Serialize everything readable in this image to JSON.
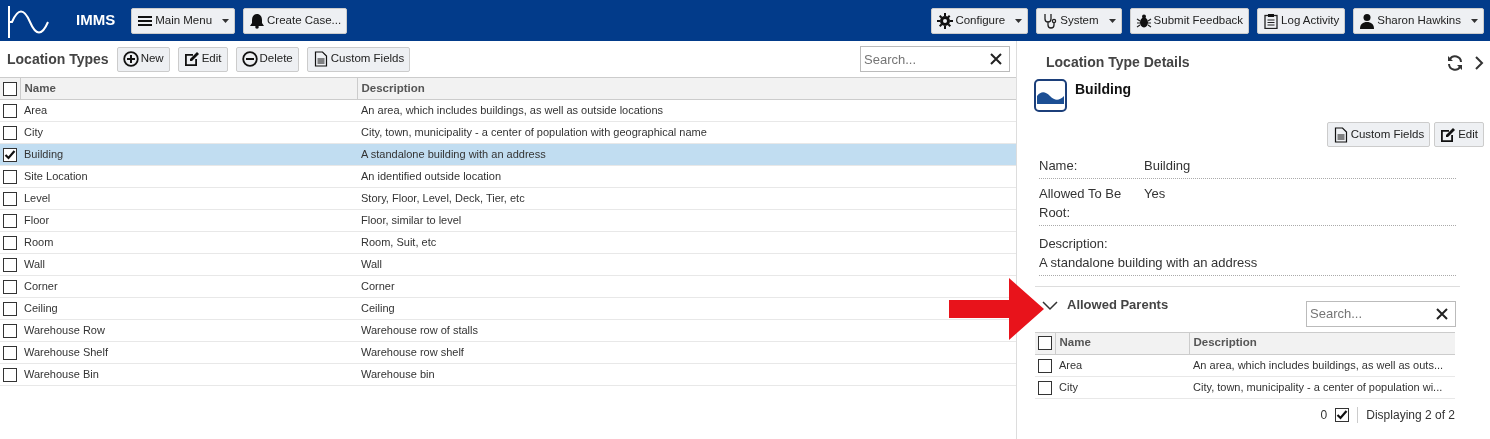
{
  "app": {
    "title": "IMMS"
  },
  "top_buttons": [
    {
      "label": "Main Menu",
      "dropdown": true
    },
    {
      "label": "Create Case...",
      "dropdown": false
    }
  ],
  "right_buttons": [
    {
      "label": "Configure",
      "dropdown": true
    },
    {
      "label": "System",
      "dropdown": true
    },
    {
      "label": "Submit Feedback",
      "dropdown": false
    },
    {
      "label": "Log Activity",
      "dropdown": false
    },
    {
      "label": "Sharon Hawkins",
      "dropdown": true
    }
  ],
  "list_panel": {
    "title": "Location Types",
    "toolbar": [
      {
        "label": "New"
      },
      {
        "label": "Edit"
      },
      {
        "label": "Delete"
      },
      {
        "label": "Custom Fields"
      }
    ],
    "search": {
      "placeholder": "Search..."
    },
    "columns": [
      "Name",
      "Description"
    ],
    "header_checked": false,
    "rows": [
      {
        "name": "Area",
        "description": "An area, which includes buildings, as well as outside locations",
        "selected": false
      },
      {
        "name": "City",
        "description": "City, town, municipality - a center of population with geographical name",
        "selected": false
      },
      {
        "name": "Building",
        "description": "A standalone building with an address",
        "selected": true
      },
      {
        "name": "Site Location",
        "description": "An identified outside location",
        "selected": false
      },
      {
        "name": "Level",
        "description": "Story, Floor, Level, Deck, Tier, etc",
        "selected": false
      },
      {
        "name": "Floor",
        "description": "Floor, similar to level",
        "selected": false
      },
      {
        "name": "Room",
        "description": "Room, Suit, etc",
        "selected": false
      },
      {
        "name": "Wall",
        "description": "Wall",
        "selected": false
      },
      {
        "name": "Corner",
        "description": "Corner",
        "selected": false
      },
      {
        "name": "Ceiling",
        "description": "Ceiling",
        "selected": false
      },
      {
        "name": "Warehouse Row",
        "description": "Warehouse row of stalls",
        "selected": false
      },
      {
        "name": "Warehouse Shelf",
        "description": "Warehouse row shelf",
        "selected": false
      },
      {
        "name": "Warehouse Bin",
        "description": "Warehouse bin",
        "selected": false
      }
    ]
  },
  "details": {
    "title": "Location Type Details",
    "item_title": "Building",
    "buttons": [
      {
        "label": "Custom Fields"
      },
      {
        "label": "Edit"
      }
    ],
    "fields": [
      {
        "label": "Name:",
        "value": "Building",
        "kind": "inline"
      },
      {
        "label": "Allowed To Be Root:",
        "value": "Yes",
        "kind": "inline"
      },
      {
        "label": "Description:",
        "value": "A standalone building with an address",
        "kind": "stacked"
      }
    ],
    "allowed_parents": {
      "title": "Allowed Parents",
      "expanded": true,
      "search": {
        "placeholder": "Search..."
      },
      "columns": [
        "Name",
        "Description"
      ],
      "header_checked": false,
      "rows": [
        {
          "name": "Area",
          "description": "An area, which includes buildings, as well as outs...",
          "selected": false
        },
        {
          "name": "City",
          "description": "City, town, municipality - a center of population wi...",
          "selected": false
        }
      ],
      "footer": {
        "count": "0",
        "checked": true,
        "status": "Displaying 2 of 2"
      }
    }
  }
}
